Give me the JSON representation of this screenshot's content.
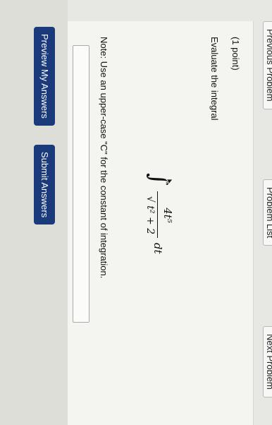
{
  "nav": {
    "previous": "Previous Problem",
    "list": "Problem List",
    "next": "Next Problem"
  },
  "problem": {
    "points": "(1 point)",
    "instruction": "Evaluate the integral",
    "integral": {
      "sign": "∫",
      "numerator": "4t⁵",
      "denominator": "√ t² + 2",
      "differential": "dt"
    },
    "note": "Note: Use an upper-case \"C\" for the constant of integration.",
    "answer_value": ""
  },
  "actions": {
    "preview_label": "Preview My Answers",
    "submit_label": "Submit Answers"
  },
  "colors": {
    "button_bg": "#1a3a7c",
    "page_bg": "#f4f4f1"
  }
}
